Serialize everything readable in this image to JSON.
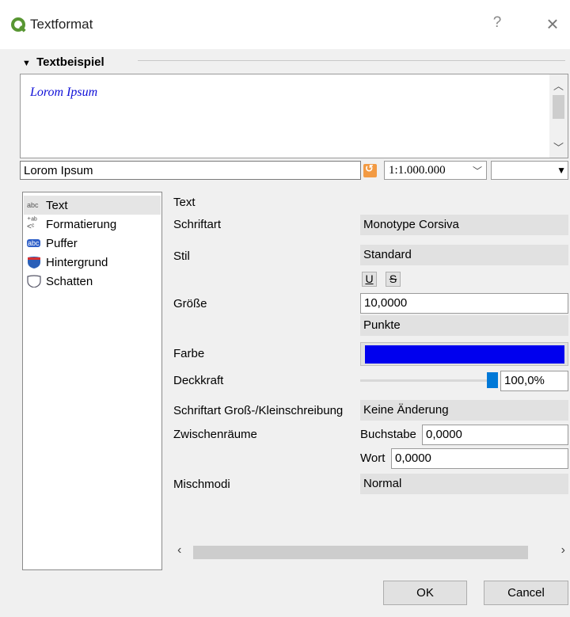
{
  "window": {
    "title": "Textformat",
    "help_label": "?",
    "close_label": "×"
  },
  "sample": {
    "section_label": "Textbeispiel",
    "preview_text": "Lorom Ipsum",
    "input_value": "Lorom Ipsum",
    "scale_value": "1:1.000.000",
    "ext_value": ""
  },
  "nav": {
    "items": [
      {
        "label": "Text",
        "icon": "abc-text-icon",
        "selected": true
      },
      {
        "label": "Formatierung",
        "icon": "formatting-icon",
        "selected": false
      },
      {
        "label": "Puffer",
        "icon": "buffer-icon",
        "selected": false
      },
      {
        "label": "Hintergrund",
        "icon": "background-shield-icon",
        "selected": false
      },
      {
        "label": "Schatten",
        "icon": "shadow-icon",
        "selected": false
      }
    ]
  },
  "form": {
    "heading": "Text",
    "font_label": "Schriftart",
    "font_value": "Monotype Corsiva",
    "style_label": "Stil",
    "style_value": "Standard",
    "underline_label": "U",
    "strike_label": "S",
    "size_label": "Größe",
    "size_value": "10,0000",
    "unit_value": "Punkte",
    "color_label": "Farbe",
    "color_hex": "#0000ee",
    "opacity_label": "Deckkraft",
    "opacity_value": "100,0%",
    "opacity_fraction": 1.0,
    "case_label": "Schriftart Groß-/Kleinschreibung",
    "case_value": "Keine Änderung",
    "spacing_label": "Zwischenräume",
    "letter_label": "Buchstabe",
    "letter_value": "0,0000",
    "word_label": "Wort",
    "word_value": "0,0000",
    "blend_label": "Mischmodi",
    "blend_value": "Normal"
  },
  "buttons": {
    "ok_label": "OK",
    "cancel_label": "Cancel"
  },
  "colors": {
    "accent": "#0078d7",
    "qgis_green": "#589632",
    "reset_orange": "#f29a43"
  }
}
